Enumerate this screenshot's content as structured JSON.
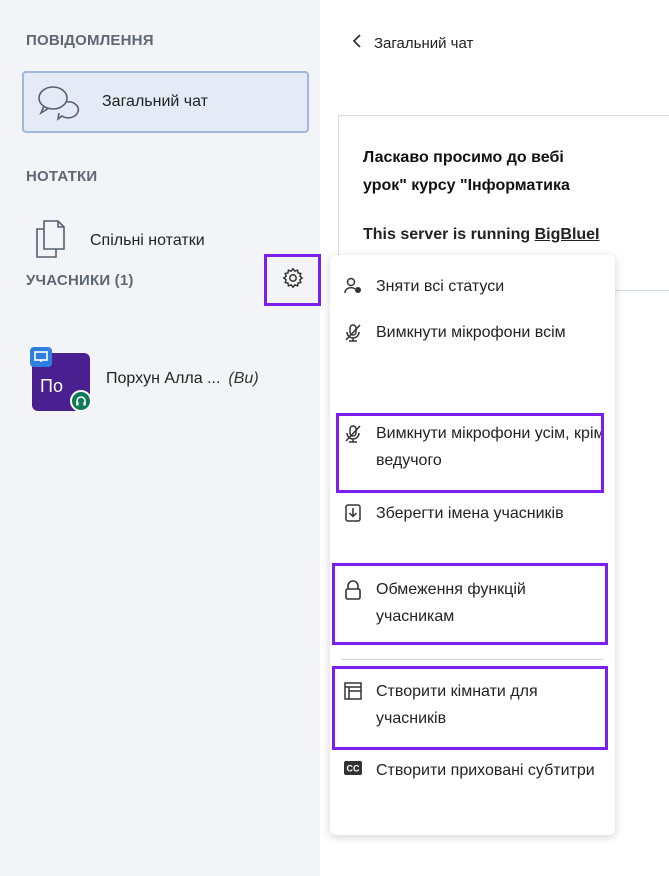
{
  "sidebar": {
    "messages_title": "ПОВІДОМЛЕННЯ",
    "chat_label": "Загальний чат",
    "notes_title": "НОТАТКИ",
    "notes_label": "Спільні нотатки",
    "users_title": "УЧАСНИКИ (1)",
    "user": {
      "initials": "По",
      "name": "Порхун Алла ...",
      "you_tag": "(Ви)"
    }
  },
  "main": {
    "header_title": "Загальний чат",
    "welcome_line1": "Ласкаво просимо до вебі",
    "welcome_line2": "урок\" курсу \"Інформатика",
    "server_prefix": "This server is running ",
    "server_link": "BigBlueI"
  },
  "menu": {
    "items": [
      {
        "label": "Зняти всі статуси",
        "icon": "clear-status-icon"
      },
      {
        "label": "Вимкнути мікрофони всім",
        "icon": "mute-icon"
      },
      {
        "label": "Вимкнути мікрофони усім, крім ведучого",
        "icon": "mute-icon"
      },
      {
        "label": "Зберегти імена учасників",
        "icon": "download-icon"
      },
      {
        "label": "Обмеження функцій учасникам",
        "icon": "lock-icon"
      },
      {
        "label": "Створити кімнати для учасників",
        "icon": "rooms-icon"
      },
      {
        "label": "Створити приховані субтитри",
        "icon": "cc-icon"
      }
    ]
  },
  "colors": {
    "highlight": "#7c1ef0",
    "avatar": "#4a1f8f",
    "audio": "#0f7a57",
    "presenter": "#2f7fe0"
  }
}
